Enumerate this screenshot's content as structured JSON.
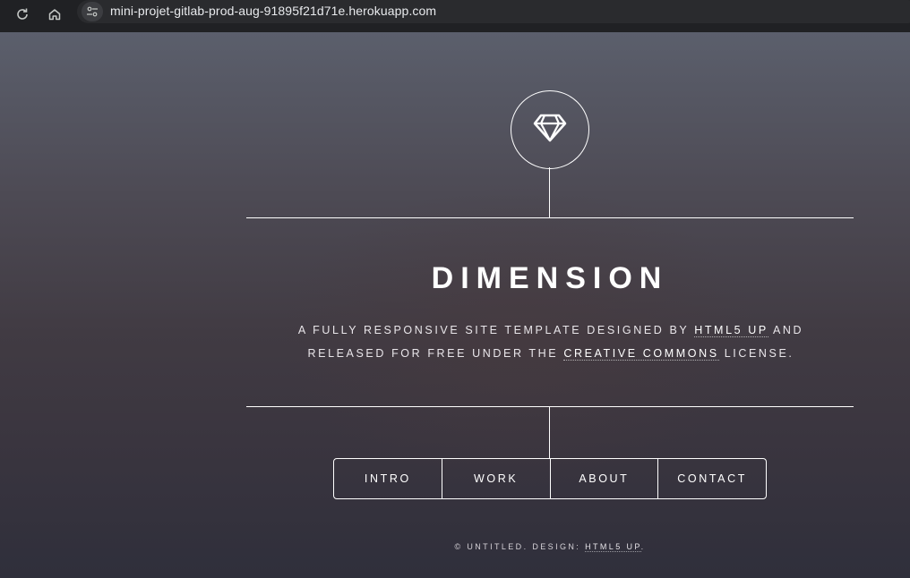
{
  "browser": {
    "url": "mini-projet-gitlab-prod-aug-91895f21d71e.herokuapp.com",
    "reload_icon": "reload-icon",
    "home_icon": "home-icon",
    "site_info_icon": "tune-icon"
  },
  "header": {
    "logo_icon": "diamond-icon",
    "title": "DIMENSION",
    "subtitle_part1": "A fully responsive site template designed by ",
    "subtitle_link1": "HTML5 UP",
    "subtitle_part2": " and released for free under the ",
    "subtitle_link2": "Creative Commons",
    "subtitle_part3": " license."
  },
  "nav": {
    "items": [
      {
        "label": "INTRO"
      },
      {
        "label": "WORK"
      },
      {
        "label": "ABOUT"
      },
      {
        "label": "CONTACT"
      }
    ]
  },
  "footer": {
    "text": "© Untitled. Design: ",
    "link": "HTML5 UP",
    "end": "."
  },
  "colors": {
    "browser_bar": "#202124",
    "accent_line": "#ffffff"
  }
}
